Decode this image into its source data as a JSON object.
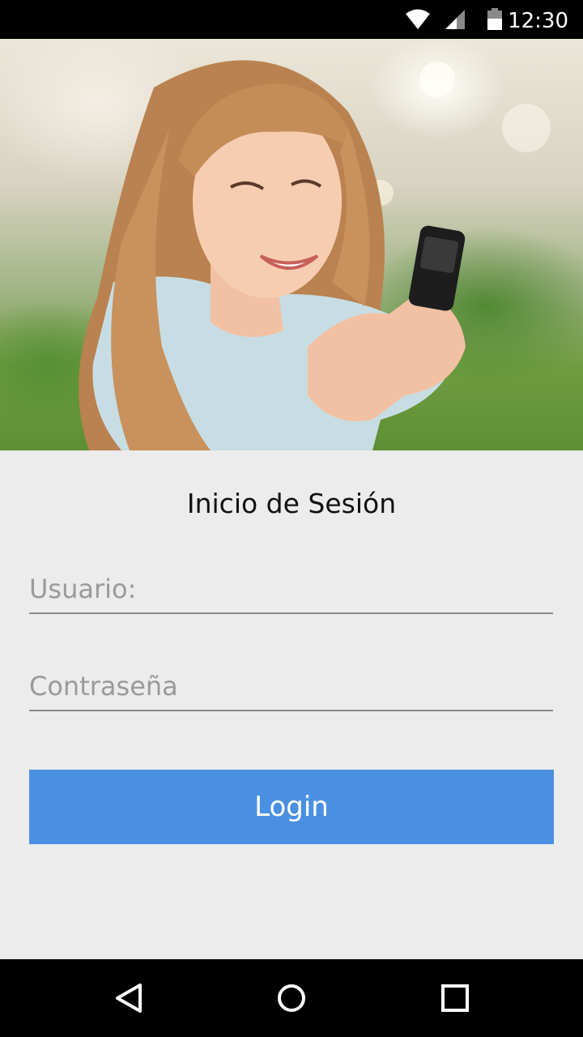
{
  "status_bar": {
    "time": "12:30",
    "icons": [
      "wifi-icon",
      "signal-icon",
      "battery-icon"
    ]
  },
  "hero": {
    "icon": "photo-girl-with-phone"
  },
  "login": {
    "title": "Inicio de Sesión",
    "username_placeholder": "Usuario:",
    "password_placeholder": "Contraseña",
    "button_label": "Login"
  },
  "nav_bar": {
    "icons": [
      "back-icon",
      "home-icon",
      "recents-icon"
    ]
  },
  "colors": {
    "accent": "#4a90e2",
    "background": "#ececec",
    "status_bar": "#000000",
    "field_underline": "#8a8a8a"
  }
}
